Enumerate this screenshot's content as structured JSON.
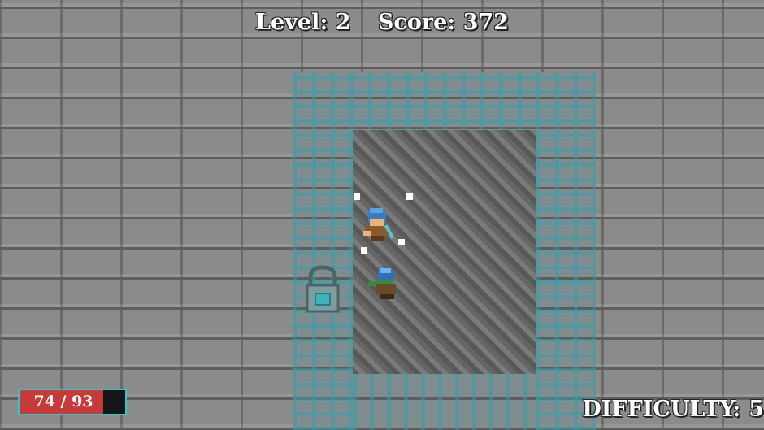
{
  "hud": {
    "level_label": "Level: 2",
    "score_label": "Score: 372",
    "difficulty_label": "DIFFICULTY:",
    "difficulty_value": "5"
  },
  "player": {
    "health_text": "74 / 93",
    "health_fraction": 0.7957
  },
  "colors": {
    "health_fill": "#c73a3a",
    "health_border": "#30c7c7",
    "hud_text": "#ffffff",
    "room_accent": "#32a0aa"
  },
  "icons": {
    "lock": "padlock-icon",
    "player": "hero-sprite",
    "enemy": "goblin-enemy-sprite",
    "aim": "aim-reticle-dots"
  }
}
